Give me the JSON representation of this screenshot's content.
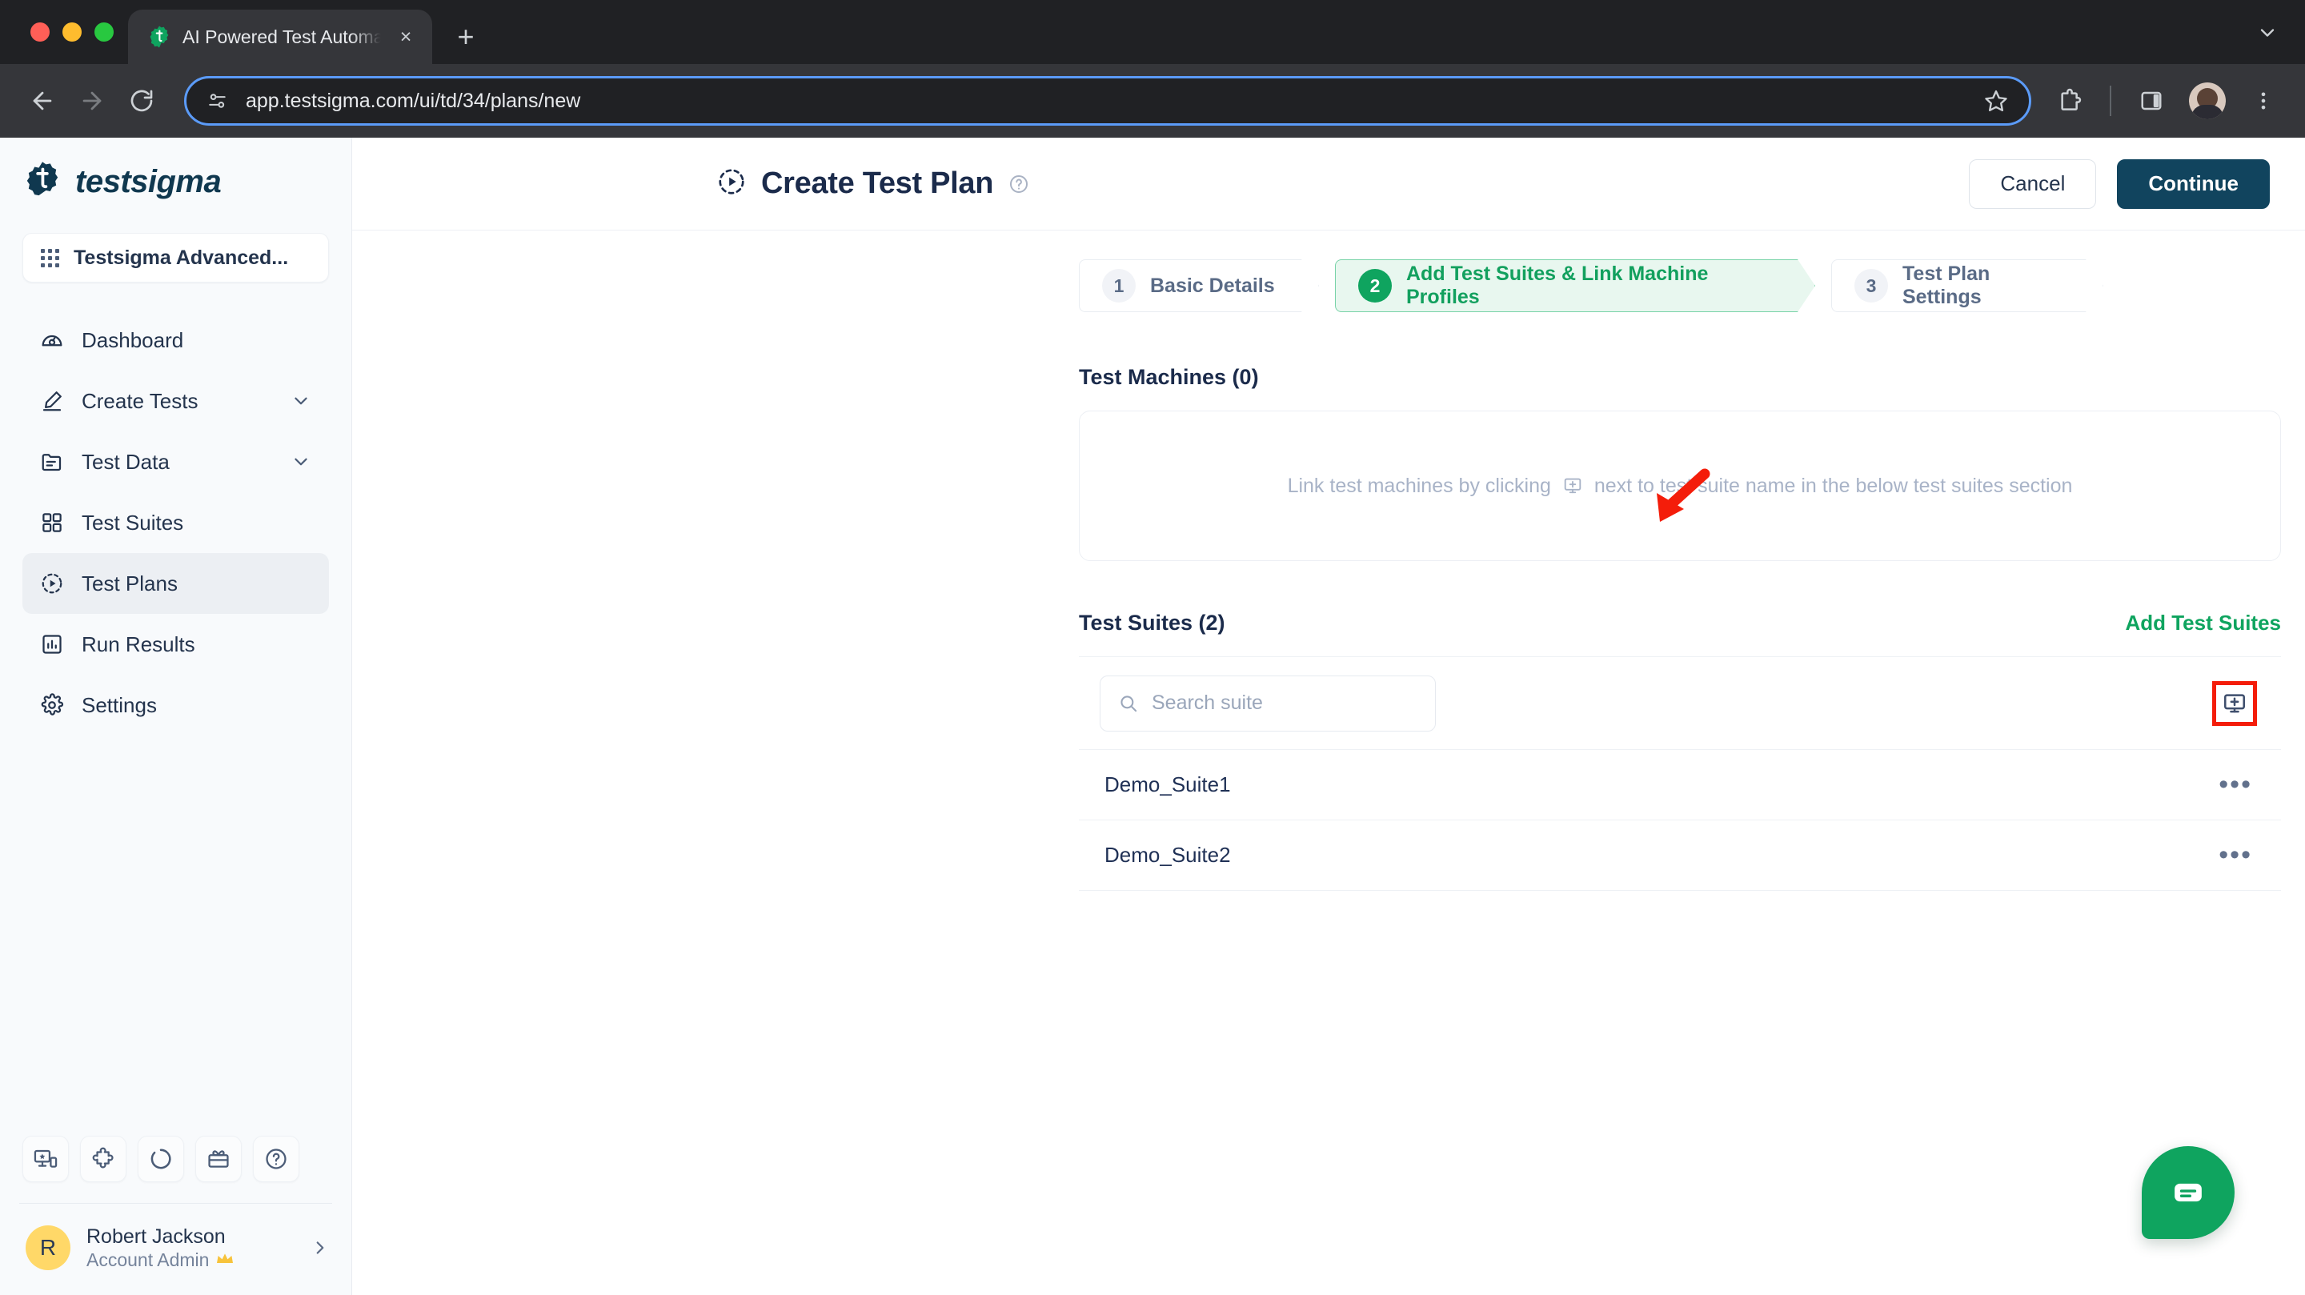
{
  "browser": {
    "tab": {
      "title": "AI Powered Test Automation",
      "favicon": "testsigma-gear-icon",
      "close": "×"
    },
    "new_tab_label": "+",
    "omnibox": {
      "url": "app.testsigma.com/ui/td/34/plans/new",
      "site_info_icon": "page-info-icon",
      "bookmark_icon": "star-icon"
    },
    "toolbar_icons": [
      "back-arrow-icon",
      "forward-arrow-icon",
      "reload-icon",
      "extensions-puzzle-icon",
      "side-panel-icon",
      "profile-avatar",
      "chrome-menu-icon"
    ],
    "tabstrip_right_icon": "chevron-down-icon"
  },
  "sidebar": {
    "logo_text": "testsigma",
    "project": {
      "label": "Testsigma Advanced...",
      "icon": "apps-grid-icon"
    },
    "items": [
      {
        "label": "Dashboard",
        "icon": "gauge-icon",
        "active": false,
        "expandable": false
      },
      {
        "label": "Create Tests",
        "icon": "pencil-icon",
        "active": false,
        "expandable": true
      },
      {
        "label": "Test Data",
        "icon": "folder-list-icon",
        "active": false,
        "expandable": true
      },
      {
        "label": "Test Suites",
        "icon": "grid-squares-icon",
        "active": false,
        "expandable": false
      },
      {
        "label": "Test Plans",
        "icon": "play-circle-dashed-icon",
        "active": true,
        "expandable": false
      },
      {
        "label": "Run Results",
        "icon": "bar-chart-box-icon",
        "active": false,
        "expandable": false
      },
      {
        "label": "Settings",
        "icon": "gear-icon",
        "active": false,
        "expandable": false
      }
    ],
    "tools": [
      "devices-star-icon",
      "puzzle-icon",
      "progress-ring-icon",
      "gift-icon",
      "help-circle-icon"
    ],
    "user": {
      "initial": "R",
      "name": "Robert Jackson",
      "role": "Account Admin",
      "role_badge": "crown-icon"
    }
  },
  "header": {
    "title": "Create Test Plan",
    "title_icon": "play-circle-dashed-icon",
    "help_icon": "help-circle-icon",
    "cancel_label": "Cancel",
    "continue_label": "Continue"
  },
  "stepper": {
    "steps": [
      {
        "num": "1",
        "label": "Basic Details",
        "active": false
      },
      {
        "num": "2",
        "label": "Add Test Suites & Link Machine Profiles",
        "active": true
      },
      {
        "num": "3",
        "label": "Test Plan Settings",
        "active": false
      }
    ]
  },
  "test_machines": {
    "heading": "Test Machines (0)",
    "empty_prefix": "Link test machines by clicking",
    "empty_icon": "monitor-plus-icon",
    "empty_suffix": "next to test suite name in the below test suites section"
  },
  "test_suites": {
    "heading": "Test Suites (2)",
    "add_link": "Add Test Suites",
    "search_placeholder": "Search suite",
    "search_value": "",
    "search_icon": "search-icon",
    "add_machine_icon": "monitor-plus-icon",
    "rows": [
      {
        "name": "Demo_Suite1",
        "menu": "•••"
      },
      {
        "name": "Demo_Suite2",
        "menu": "•••"
      }
    ]
  },
  "chat": {
    "icon": "chat-bubble-icon"
  },
  "annotations": {
    "arrow": {
      "color": "#f41d0a",
      "points_to": "active-step-2"
    },
    "highlight_box": {
      "color": "#f41d0a",
      "target": "add-machine-button"
    }
  },
  "colors": {
    "brand_dark": "#11445e",
    "accent_green": "#0fa45f",
    "annotation_red": "#f41d0a",
    "text_primary": "#1b2b4b",
    "sidebar_bg": "#f8fafc"
  }
}
